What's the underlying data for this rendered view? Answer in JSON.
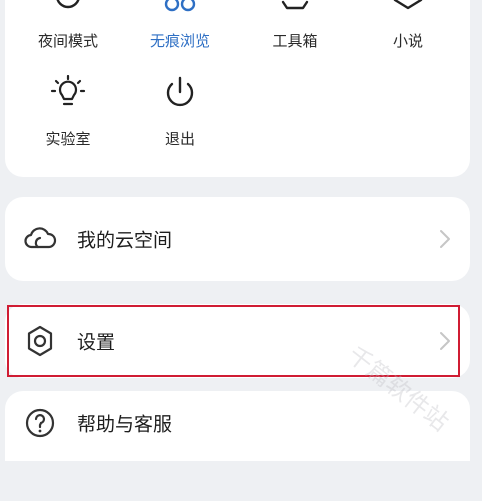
{
  "quick_grid": {
    "row1": [
      {
        "label": "夜间模式",
        "icon": "moon-icon",
        "active": false
      },
      {
        "label": "无痕浏览",
        "icon": "incognito-icon",
        "active": true
      },
      {
        "label": "工具箱",
        "icon": "toolbox-icon",
        "active": false
      },
      {
        "label": "小说",
        "icon": "book-icon",
        "active": false
      }
    ],
    "row2": [
      {
        "label": "实验室",
        "icon": "bulb-icon"
      },
      {
        "label": "退出",
        "icon": "power-icon"
      }
    ]
  },
  "menu": {
    "cloud": {
      "label": "我的云空间",
      "icon": "cloud-icon"
    },
    "settings": {
      "label": "设置",
      "icon": "gear-icon"
    },
    "help": {
      "label": "帮助与客服",
      "icon": "help-icon"
    }
  },
  "colors": {
    "accent": "#2e6fc4",
    "highlight": "#d01c33",
    "background": "#eef0f3"
  },
  "watermark": "千篇软件站"
}
